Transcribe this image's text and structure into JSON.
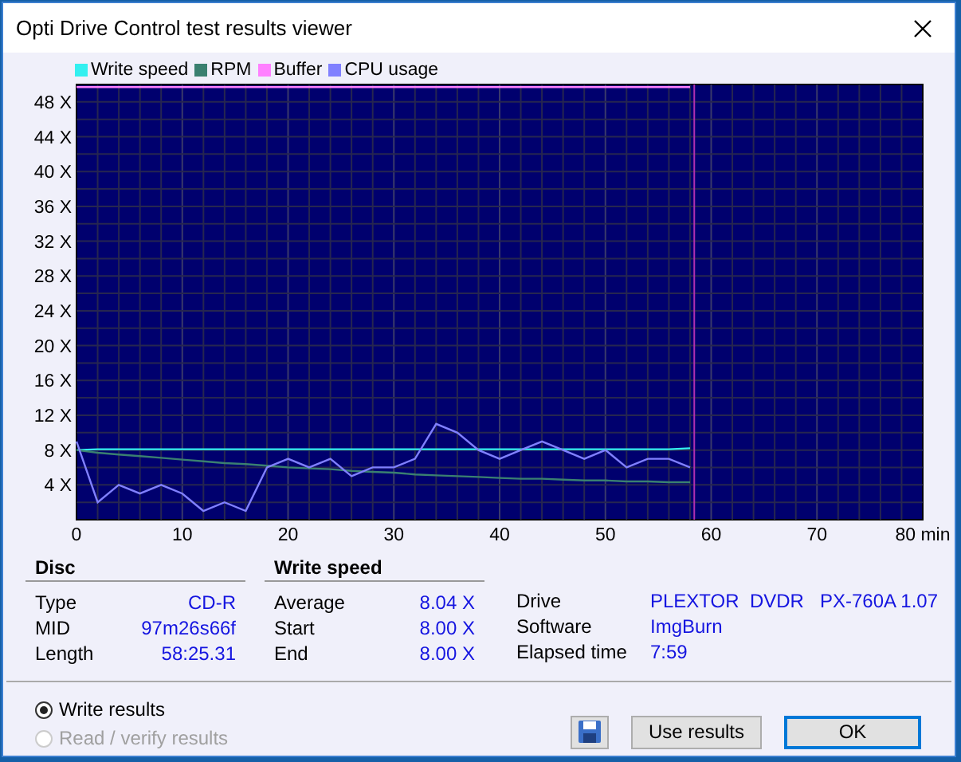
{
  "window": {
    "title": "Opti Drive Control test results viewer"
  },
  "chart": {
    "chart_data": {
      "type": "line",
      "x": [
        0,
        2,
        4,
        6,
        8,
        10,
        12,
        14,
        16,
        18,
        20,
        22,
        24,
        26,
        28,
        30,
        32,
        34,
        36,
        38,
        40,
        42,
        44,
        46,
        48,
        50,
        52,
        54,
        56,
        58
      ],
      "xlim": [
        0,
        80
      ],
      "grid": true,
      "ref_lines": [
        {
          "axis": "x",
          "value": 58.4,
          "color": "#b030b0"
        }
      ],
      "ylim": [
        0,
        50
      ],
      "xticks": [
        0,
        10,
        20,
        30,
        40,
        50,
        60,
        70,
        {
          "value": 80,
          "label": "80 min"
        }
      ],
      "yticks": [
        {
          "value": 4,
          "label": "4 X"
        },
        {
          "value": 8,
          "label": "8 X"
        },
        {
          "value": 12,
          "label": "12 X"
        },
        {
          "value": 16,
          "label": "16 X"
        },
        {
          "value": 20,
          "label": "20 X"
        },
        {
          "value": 24,
          "label": "24 X"
        },
        {
          "value": 28,
          "label": "28 X"
        },
        {
          "value": 32,
          "label": "32 X"
        },
        {
          "value": 36,
          "label": "36 X"
        },
        {
          "value": 40,
          "label": "40 X"
        },
        {
          "value": 44,
          "label": "44 X"
        },
        {
          "value": 48,
          "label": "48 X"
        }
      ],
      "series": [
        {
          "name": "Write speed",
          "color": "#33f0f0",
          "values": [
            8,
            8.1,
            8.1,
            8.1,
            8.1,
            8.1,
            8.1,
            8.1,
            8.1,
            8.1,
            8.1,
            8.1,
            8.1,
            8.1,
            8.1,
            8.1,
            8.1,
            8.1,
            8.1,
            8.1,
            8.1,
            8.1,
            8.1,
            8.1,
            8.1,
            8.1,
            8.1,
            8.1,
            8.1,
            8.2
          ]
        },
        {
          "name": "RPM",
          "color": "#3a8070",
          "values": [
            8,
            7.7,
            7.5,
            7.3,
            7.1,
            6.9,
            6.7,
            6.5,
            6.4,
            6.2,
            6.0,
            5.9,
            5.8,
            5.6,
            5.5,
            5.4,
            5.2,
            5.1,
            5.0,
            4.9,
            4.8,
            4.7,
            4.7,
            4.6,
            4.5,
            4.5,
            4.4,
            4.4,
            4.3,
            4.3
          ]
        },
        {
          "name": "Buffer",
          "color": "#ff80ff",
          "values": [
            49.7,
            49.7,
            49.7,
            49.7,
            49.7,
            49.7,
            49.7,
            49.7,
            49.7,
            49.7,
            49.7,
            49.7,
            49.7,
            49.7,
            49.7,
            49.7,
            49.7,
            49.7,
            49.7,
            49.7,
            49.7,
            49.7,
            49.7,
            49.7,
            49.7,
            49.7,
            49.7,
            49.7,
            49.7,
            49.7
          ]
        },
        {
          "name": "CPU usage",
          "color": "#8080ff",
          "values": [
            9,
            2,
            4,
            3,
            4,
            3,
            1,
            2,
            1,
            6,
            7,
            6,
            7,
            5,
            6,
            6,
            7,
            11,
            10,
            8,
            7,
            8,
            9,
            8,
            7,
            8,
            6,
            7,
            7,
            6
          ]
        }
      ]
    }
  },
  "disc": {
    "heading": "Disc",
    "rows": [
      {
        "label": "Type",
        "value": "CD-R"
      },
      {
        "label": "MID",
        "value": "97m26s66f"
      },
      {
        "label": "Length",
        "value": "58:25.31"
      }
    ]
  },
  "write_speed": {
    "heading": "Write speed",
    "rows": [
      {
        "label": "Average",
        "value": "8.04 X"
      },
      {
        "label": "Start",
        "value": "8.00 X"
      },
      {
        "label": "End",
        "value": "8.00 X"
      }
    ]
  },
  "drive_info": {
    "rows": [
      {
        "label": "Drive",
        "value": "PLEXTOR  DVDR   PX-760A 1.07"
      },
      {
        "label": "Software",
        "value": "ImgBurn"
      },
      {
        "label": "Elapsed time",
        "value": "7:59"
      }
    ]
  },
  "options": [
    {
      "label": "Write results",
      "selected": true,
      "disabled": false
    },
    {
      "label": "Read / verify results",
      "selected": false,
      "disabled": true
    }
  ],
  "buttons": [
    {
      "kind": "icon"
    },
    {
      "kind": "text",
      "label": "Use results",
      "default": false
    },
    {
      "kind": "text",
      "label": "OK",
      "default": true
    }
  ]
}
